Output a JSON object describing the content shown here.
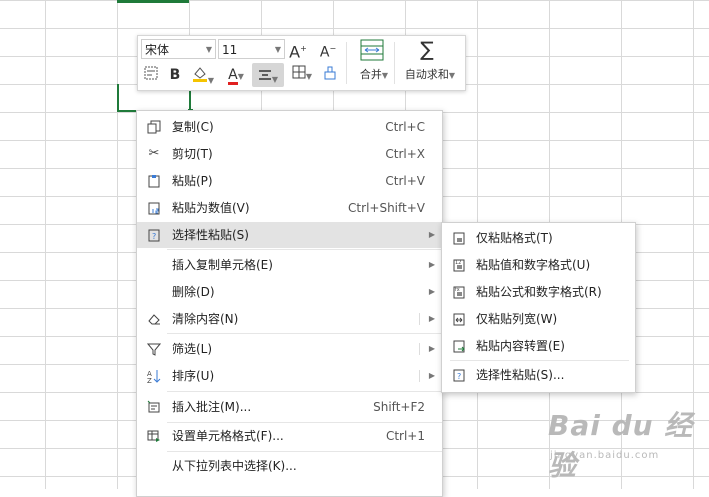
{
  "toolbar": {
    "font_name": "宋体",
    "font_size": "11",
    "increase_font_label": "A",
    "decrease_font_label": "A",
    "bold_label": "B",
    "font_color_label": "A",
    "merge_label": "合并",
    "autosum_label": "自动求和",
    "colors": {
      "highlight": "#f5c400",
      "font_color": "#e02020"
    }
  },
  "context_menu": {
    "items": [
      {
        "label": "复制(C)",
        "shortcut": "Ctrl+C",
        "icon": "copy-icon"
      },
      {
        "label": "剪切(T)",
        "shortcut": "Ctrl+X",
        "icon": "scissors-icon"
      },
      {
        "label": "粘贴(P)",
        "shortcut": "Ctrl+V",
        "icon": "paste-icon"
      },
      {
        "label": "粘贴为数值(V)",
        "shortcut": "Ctrl+Shift+V",
        "icon": "paste-values-icon"
      },
      {
        "label": "选择性粘贴(S)",
        "icon": "paste-special-icon"
      },
      {
        "label": "插入复制单元格(E)"
      },
      {
        "label": "删除(D)"
      },
      {
        "label": "清除内容(N)",
        "icon": "eraser-icon"
      },
      {
        "label": "筛选(L)",
        "icon": "filter-icon"
      },
      {
        "label": "排序(U)",
        "icon": "sort-icon"
      },
      {
        "label": "插入批注(M)...",
        "shortcut": "Shift+F2",
        "icon": "comment-icon"
      },
      {
        "label": "设置单元格格式(F)...",
        "shortcut": "Ctrl+1",
        "icon": "format-cells-icon"
      },
      {
        "label": "从下拉列表中选择(K)..."
      }
    ]
  },
  "submenu": {
    "items": [
      {
        "label": "仅粘贴格式(T)",
        "icon": "paste-format-icon"
      },
      {
        "label": "粘贴值和数字格式(U)",
        "icon": "paste-values-number-icon"
      },
      {
        "label": "粘贴公式和数字格式(R)",
        "icon": "paste-formula-number-icon"
      },
      {
        "label": "仅粘贴列宽(W)",
        "icon": "paste-column-width-icon"
      },
      {
        "label": "粘贴内容转置(E)",
        "icon": "paste-transpose-icon"
      },
      {
        "label": "选择性粘贴(S)...",
        "icon": "paste-special-icon"
      }
    ]
  },
  "watermark": {
    "brand": "Bai du 经验",
    "url": "jingyan.baidu.com"
  }
}
